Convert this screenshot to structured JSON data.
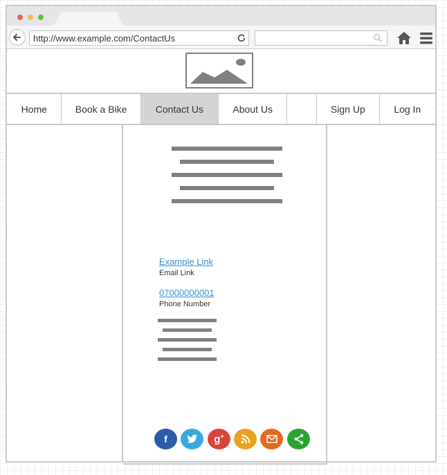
{
  "browser": {
    "url": "http://www.example.com/ContactUs",
    "controls": {
      "back_icon": "back-arrow-icon",
      "reload_icon": "reload-icon",
      "search_icon": "search-icon",
      "home_icon": "home-icon",
      "menu_icon": "hamburger-menu-icon"
    },
    "window_dots": [
      "#ec5f5f",
      "#f5bd4f",
      "#5bc345"
    ]
  },
  "header": {
    "logo_icon": "image-placeholder-icon"
  },
  "nav": {
    "items": [
      {
        "label": "Home"
      },
      {
        "label": "Book a Bike"
      },
      {
        "label": "Contact Us",
        "active": true
      },
      {
        "label": "About Us"
      },
      {
        "label": ""
      },
      {
        "label": "Sign Up"
      },
      {
        "label": "Log In"
      }
    ]
  },
  "main": {
    "email": {
      "link": "Example Link",
      "label": "Email Link"
    },
    "phone": {
      "link": "07000000001",
      "label": "Phone Number"
    }
  },
  "social": [
    {
      "name": "facebook",
      "color": "#2a5ca8",
      "glyph": "f"
    },
    {
      "name": "twitter",
      "color": "#38a9e0",
      "glyph": "t"
    },
    {
      "name": "google-plus",
      "color": "#d9453a",
      "glyph": "g+"
    },
    {
      "name": "rss",
      "color": "#e8a223",
      "glyph": "rss"
    },
    {
      "name": "email",
      "color": "#e36a1f",
      "glyph": "mail"
    },
    {
      "name": "share",
      "color": "#2ba42f",
      "glyph": "share"
    }
  ]
}
